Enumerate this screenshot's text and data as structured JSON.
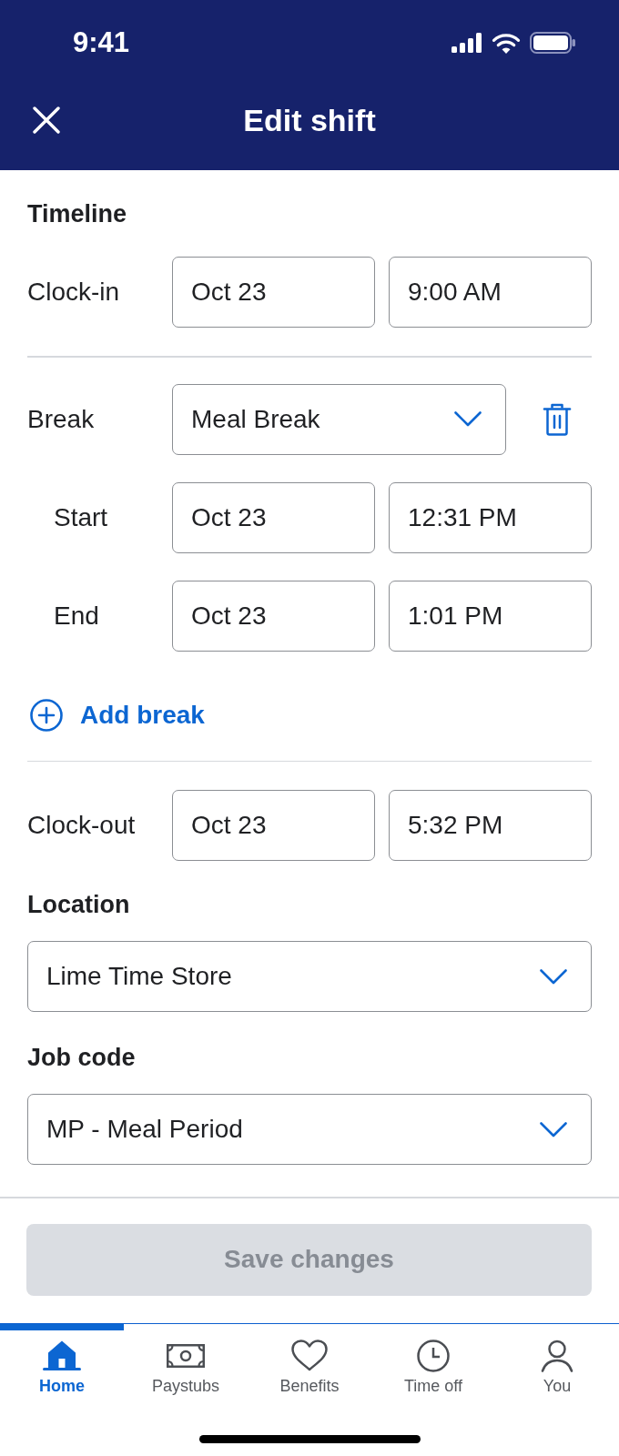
{
  "status_bar": {
    "time": "9:41"
  },
  "header": {
    "title": "Edit shift"
  },
  "timeline": {
    "heading": "Timeline",
    "clock_in": {
      "label": "Clock-in",
      "date": "Oct 23",
      "time": "9:00 AM"
    },
    "breaks": [
      {
        "label": "Break",
        "type": "Meal Break",
        "start": {
          "label": "Start",
          "date": "Oct 23",
          "time": "12:31 PM"
        },
        "end": {
          "label": "End",
          "date": "Oct 23",
          "time": "1:01 PM"
        }
      }
    ],
    "add_break": "Add break",
    "clock_out": {
      "label": "Clock-out",
      "date": "Oct 23",
      "time": "5:32 PM"
    }
  },
  "location": {
    "heading": "Location",
    "value": "Lime Time Store"
  },
  "job_code": {
    "heading": "Job code",
    "value": "MP - Meal Period"
  },
  "save_button": {
    "label": "Save changes",
    "disabled": true
  },
  "nav": [
    {
      "label": "Home",
      "selected": true
    },
    {
      "label": "Paystubs",
      "selected": false
    },
    {
      "label": "Benefits",
      "selected": false
    },
    {
      "label": "Time off",
      "selected": false
    },
    {
      "label": "You",
      "selected": false
    }
  ]
}
